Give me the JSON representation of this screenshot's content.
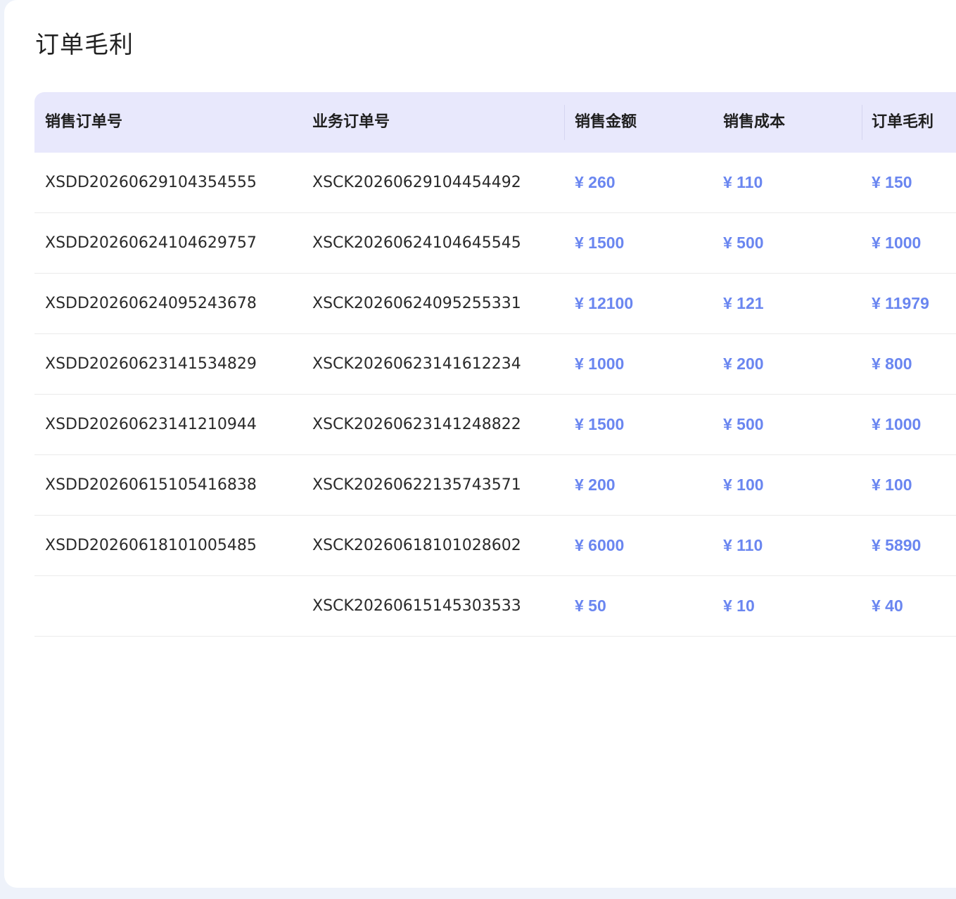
{
  "page": {
    "title": "订单毛利"
  },
  "table": {
    "headers": [
      "销售订单号",
      "业务订单号",
      "销售金额",
      "销售成本",
      "订单毛利"
    ],
    "rows": [
      {
        "sales_order": "XSDD20260629104354555",
        "business_order": "XSCK20260629104454492",
        "amount": "¥ 260",
        "cost": "¥ 110",
        "profit": "¥ 150"
      },
      {
        "sales_order": "XSDD20260624104629757",
        "business_order": "XSCK20260624104645545",
        "amount": "¥ 1500",
        "cost": "¥ 500",
        "profit": "¥ 1000"
      },
      {
        "sales_order": "XSDD20260624095243678",
        "business_order": "XSCK20260624095255331",
        "amount": "¥ 12100",
        "cost": "¥ 121",
        "profit": "¥ 11979"
      },
      {
        "sales_order": "XSDD20260623141534829",
        "business_order": "XSCK20260623141612234",
        "amount": "¥ 1000",
        "cost": "¥ 200",
        "profit": "¥ 800"
      },
      {
        "sales_order": "XSDD20260623141210944",
        "business_order": "XSCK20260623141248822",
        "amount": "¥ 1500",
        "cost": "¥ 500",
        "profit": "¥ 1000"
      },
      {
        "sales_order": "XSDD20260615105416838",
        "business_order": "XSCK20260622135743571",
        "amount": "¥ 200",
        "cost": "¥ 100",
        "profit": "¥ 100"
      },
      {
        "sales_order": "XSDD20260618101005485",
        "business_order": "XSCK20260618101028602",
        "amount": "¥ 6000",
        "cost": "¥ 110",
        "profit": "¥ 5890"
      },
      {
        "sales_order": "",
        "business_order": "XSCK20260615145303533",
        "amount": "¥ 50",
        "cost": "¥ 10",
        "profit": "¥ 40"
      }
    ]
  },
  "colors": {
    "header_bg": "#e8e8fc",
    "money": "#6a86f0",
    "text": "#2a2a2a"
  }
}
